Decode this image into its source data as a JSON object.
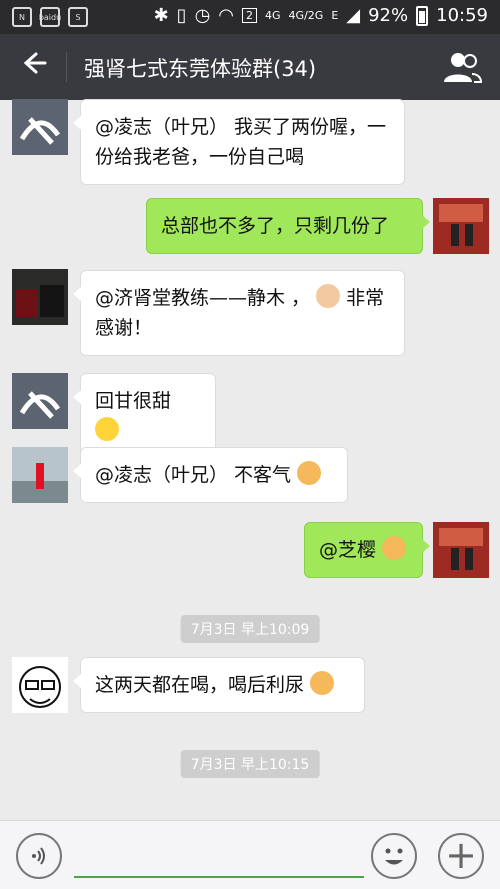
{
  "status_bar": {
    "left_icons": [
      "n-icon",
      "baidu-icon",
      "s-icon"
    ],
    "baidu_label": "baidu",
    "net_labels": [
      "4G",
      "4G",
      "2G",
      "E"
    ],
    "sim_badge": "2",
    "battery": "92%",
    "time": "10:59"
  },
  "header": {
    "back_icon": "back-arrow-icon",
    "title": "强肾七式东莞体验群(34)",
    "group_icon": "group-members-icon"
  },
  "messages": [
    {
      "side": "left",
      "avatar": "calligraphy-avatar",
      "text": "@凌志（叶兄） 我买了两份喔，一份给我老爸，一份自己喝"
    },
    {
      "side": "right",
      "avatar": "self-avatar",
      "text": "总部也不多了，只剩几份了"
    },
    {
      "side": "left",
      "avatar": "bags-avatar",
      "text": "@济肾堂教练——静木 ，",
      "text2": "非常感谢！",
      "emoji": "ok-hand-emoji"
    },
    {
      "side": "left",
      "avatar": "calligraphy-avatar",
      "text": "回甘很甜",
      "emoji": "smile-emoji"
    },
    {
      "side": "left",
      "avatar": "beach-avatar",
      "text": "@凌志（叶兄） 不客气",
      "emoji": "hand-wave-emoji"
    },
    {
      "side": "right",
      "avatar": "self-avatar",
      "text": "@芝樱",
      "emoji": "ok-hand-emoji"
    },
    {
      "type": "time",
      "text": "7月3日 早上10:09"
    },
    {
      "side": "left",
      "avatar": "cartoon-face-avatar",
      "text": "这两天都在喝，喝后利尿",
      "emoji": "thumbs-up-emoji"
    },
    {
      "type": "time",
      "text": "7月3日 早上10:15"
    }
  ],
  "input_bar": {
    "voice_icon": "voice-input-icon",
    "emoji_icon": "emoji-icon",
    "plus_icon": "plus-icon"
  },
  "colors": {
    "title_bar": "#393a3f",
    "status_bar": "#2b2b2d",
    "chat_bg": "#ebebeb",
    "green_bubble": "#a0e75a",
    "white_bubble": "#ffffff",
    "input_accent": "#4aa54a"
  }
}
